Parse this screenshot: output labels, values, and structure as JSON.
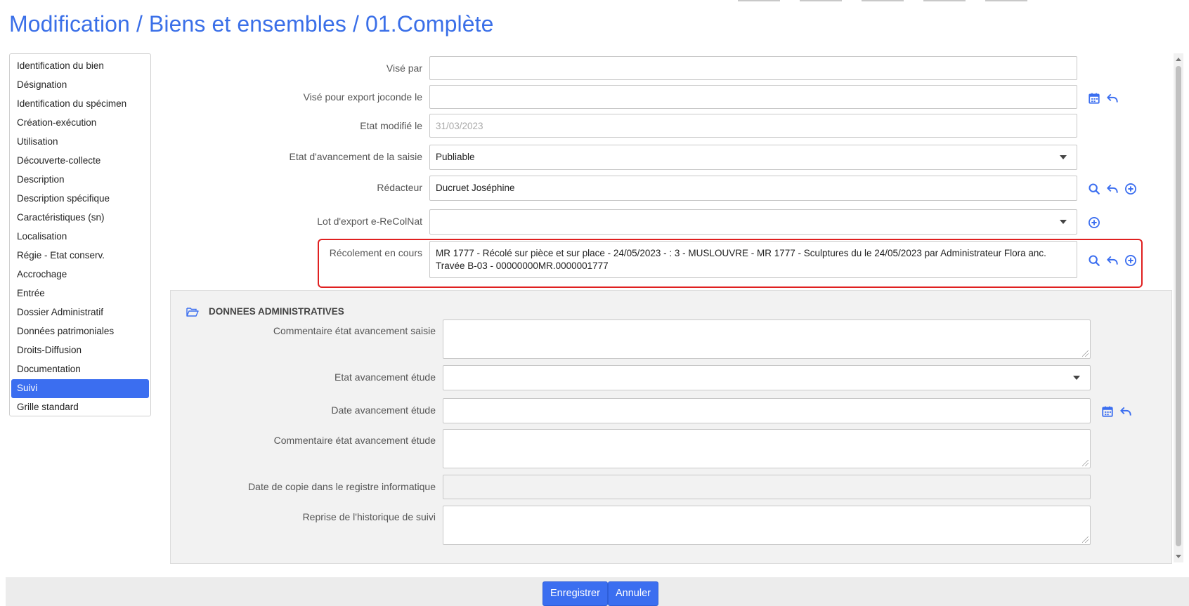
{
  "page_title": "Modification / Biens et ensembles / 01.Complète",
  "nav": {
    "items": [
      {
        "label": "Identification du bien",
        "active": false
      },
      {
        "label": "Désignation",
        "active": false
      },
      {
        "label": "Identification du spécimen",
        "active": false
      },
      {
        "label": "Création-exécution",
        "active": false
      },
      {
        "label": "Utilisation",
        "active": false
      },
      {
        "label": "Découverte-collecte",
        "active": false
      },
      {
        "label": "Description",
        "active": false
      },
      {
        "label": "Description spécifique",
        "active": false
      },
      {
        "label": "Caractéristiques (sn)",
        "active": false
      },
      {
        "label": "Localisation",
        "active": false
      },
      {
        "label": "Régie - Etat conserv.",
        "active": false
      },
      {
        "label": "Accrochage",
        "active": false
      },
      {
        "label": "Entrée",
        "active": false
      },
      {
        "label": "Dossier Administratif",
        "active": false
      },
      {
        "label": "Données patrimoniales",
        "active": false
      },
      {
        "label": "Droits-Diffusion",
        "active": false
      },
      {
        "label": "Documentation",
        "active": false
      },
      {
        "label": "Suivi",
        "active": true
      },
      {
        "label": "Grille standard",
        "active": false
      }
    ]
  },
  "form": {
    "vise_par": {
      "label": "Visé par",
      "value": ""
    },
    "vise_export": {
      "label": "Visé pour export joconde le",
      "value": ""
    },
    "etat_modifie": {
      "label": "Etat modifié le",
      "value": "31/03/2023"
    },
    "etat_avancement": {
      "label": "Etat d'avancement de la saisie",
      "value": "Publiable"
    },
    "redacteur": {
      "label": "Rédacteur",
      "value": "Ducruet Joséphine"
    },
    "lot_export": {
      "label": "Lot d'export e-ReColNat",
      "value": ""
    },
    "recolement": {
      "label": "Récolement en cours",
      "line1": "MR 1777 - Récolé sur pièce et sur place - 24/05/2023 - : 3 - MUSLOUVRE - MR 1777 - Sculptures du le 24/05/2023 par Administrateur Flora anc.",
      "line2": "Travée B-03 - 00000000MR.0000001777"
    }
  },
  "section": {
    "title": "DONNEES ADMINISTRATIVES",
    "commentaire_saisie": {
      "label": "Commentaire état avancement saisie",
      "value": ""
    },
    "etat_etude": {
      "label": "Etat avancement étude",
      "value": ""
    },
    "date_etude": {
      "label": "Date avancement étude",
      "value": ""
    },
    "commentaire_etude": {
      "label": "Commentaire état avancement étude",
      "value": ""
    },
    "date_copie": {
      "label": "Date de copie dans le registre informatique",
      "value": ""
    },
    "reprise": {
      "label": "Reprise de l'historique de suivi",
      "value": ""
    }
  },
  "buttons": {
    "save": "Enregistrer",
    "cancel": "Annuler"
  },
  "colors": {
    "accent": "#3b6ef0",
    "highlight": "#e02020",
    "title": "#3a6fe8"
  }
}
